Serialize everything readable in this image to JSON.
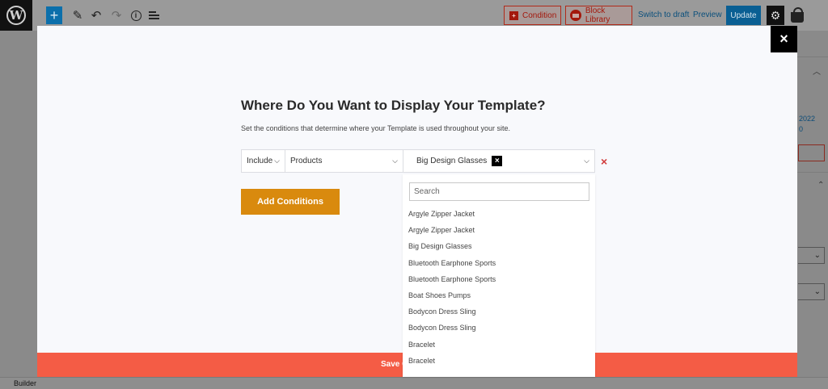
{
  "toolbar": {
    "condition_label": "Condition",
    "block_library_label": "Block Library",
    "switch_to_draft_label": "Switch to draft",
    "preview_label": "Preview",
    "update_label": "Update",
    "add_glyph": "+",
    "icons": [
      "wordpress-logo",
      "add-block",
      "pencil",
      "undo",
      "redo",
      "info",
      "list-view",
      "gear",
      "shopping-bag"
    ]
  },
  "sidebar_fragments": {
    "date_fragment": "2022",
    "number_fragment": "0"
  },
  "modal": {
    "title": "Where Do You Want to Display Your Template?",
    "subtitle": "Set the conditions that determine where your Template is used throughout your site.",
    "close_glyph": "×",
    "condition_row": {
      "include_value": "Include",
      "type_value": "Products",
      "selected_item": "Big Design Glasses",
      "chip_remove_glyph": "×",
      "row_remove_glyph": "×"
    },
    "add_conditions_label": "Add Conditions",
    "save_label": "Save C"
  },
  "dropdown": {
    "search_placeholder": "Search",
    "options": [
      "Argyle Zipper Jacket",
      "Argyle Zipper Jacket",
      "Big Design Glasses",
      "Bluetooth Earphone Sports",
      "Bluetooth Earphone Sports",
      "Boat Shoes Pumps",
      "Bodycon Dress Sling",
      "Bodycon Dress Sling",
      "Bracelet",
      "Bracelet"
    ]
  },
  "footer": {
    "label": "Builder"
  },
  "colors": {
    "accent_blue": "#0b6fab",
    "condition_red": "#a3180c",
    "add_conditions_orange": "#d98a0e",
    "save_bar": "#f45c45",
    "remove_red": "#d13b3b"
  }
}
